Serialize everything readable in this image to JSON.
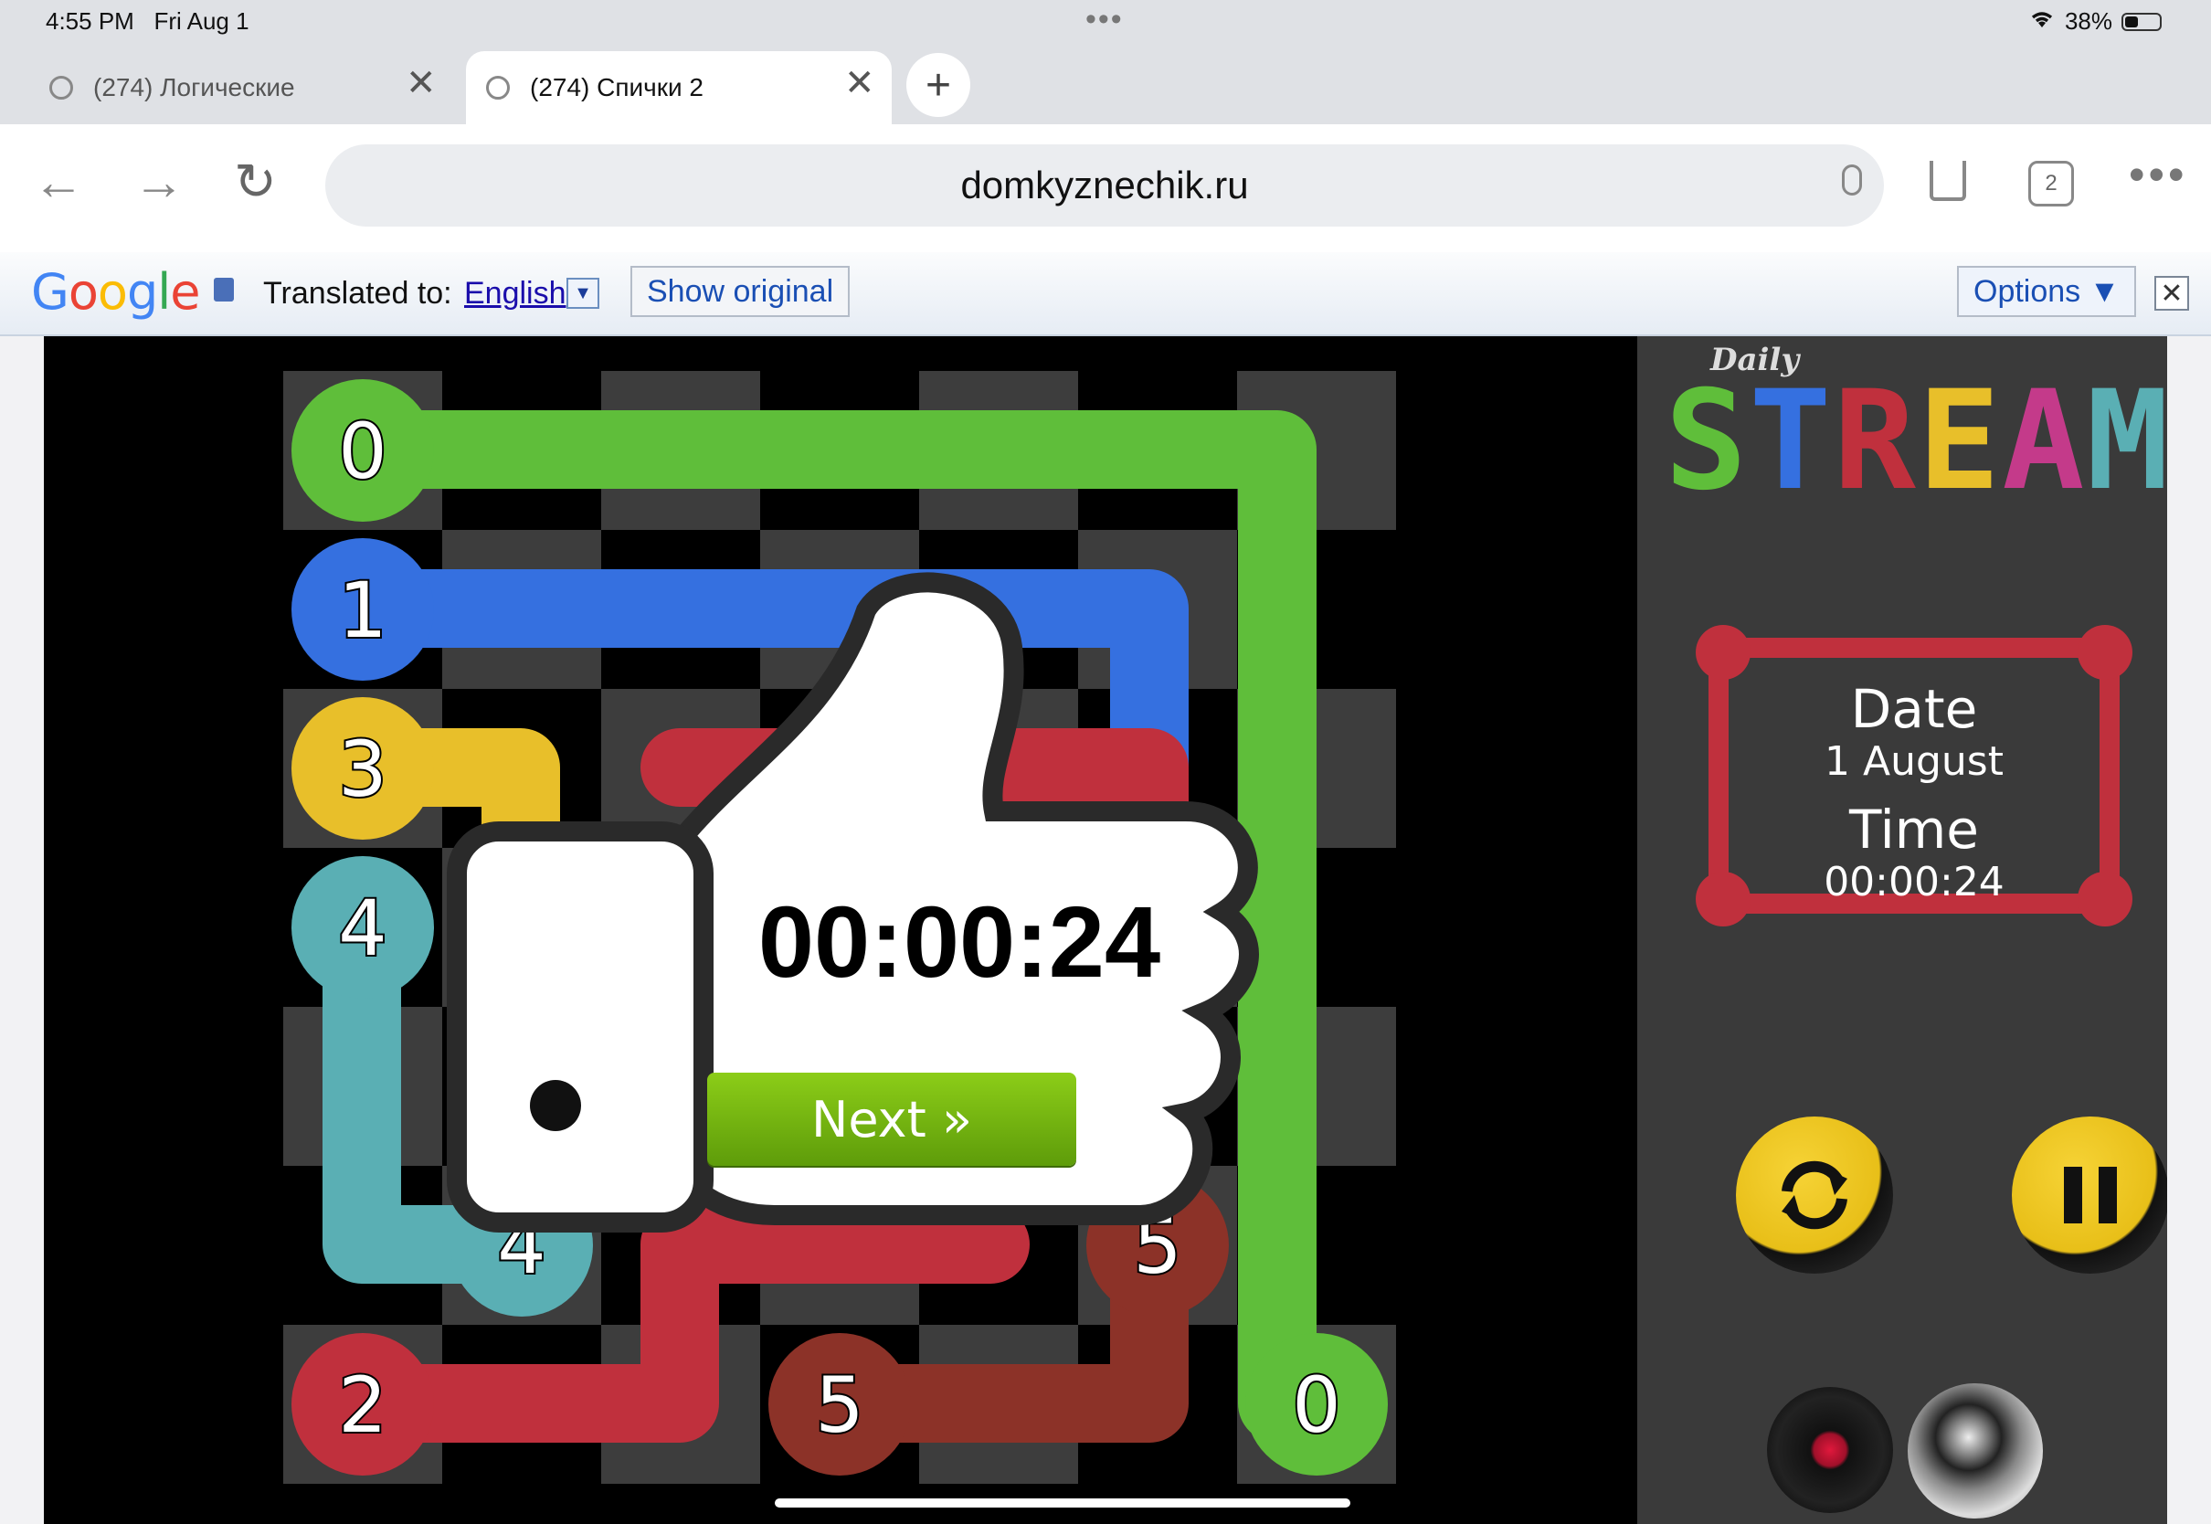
{
  "status": {
    "time": "4:55 PM",
    "date": "Fri Aug 1",
    "battery": "38%"
  },
  "tabs": [
    {
      "label": "(274) Логические"
    },
    {
      "label": "(274) Спички 2"
    }
  ],
  "address": {
    "url": "domkyznechik.ru",
    "tab_count": "2"
  },
  "translate": {
    "logo": "Google",
    "translated_to": "Translated to:",
    "language": "English",
    "show_original": "Show original",
    "options": "Options ▼"
  },
  "board": {
    "cols": 7,
    "rows": 7,
    "endpoints": [
      {
        "label": "0",
        "color": "#5fbe3a",
        "col": 0,
        "row": 0
      },
      {
        "label": "0",
        "color": "#5fbe3a",
        "col": 6,
        "row": 6
      },
      {
        "label": "1",
        "color": "#3570e0",
        "col": 0,
        "row": 1
      },
      {
        "label": "3",
        "color": "#e8bf2a",
        "col": 0,
        "row": 2
      },
      {
        "label": "4",
        "color": "#5aafb4",
        "col": 0,
        "row": 3
      },
      {
        "label": "4",
        "color": "#5aafb4",
        "col": 1,
        "row": 5
      },
      {
        "label": "5",
        "color": "#8c3228",
        "col": 5,
        "row": 5
      },
      {
        "label": "5",
        "color": "#8c3228",
        "col": 3,
        "row": 6
      },
      {
        "label": "2",
        "color": "#c0303d",
        "col": 0,
        "row": 6
      }
    ]
  },
  "result": {
    "time": "00:00:24",
    "next": "Next »"
  },
  "sidebar": {
    "daily": "Daily",
    "title": "STREAM",
    "title_colors": [
      "#5fbe3a",
      "#3570e0",
      "#c0303d",
      "#e8bf2a",
      "#c43a8a",
      "#5aafb4"
    ],
    "date_label": "Date",
    "date_value": "1 August",
    "time_label": "Time",
    "time_value": "00:00:24"
  }
}
